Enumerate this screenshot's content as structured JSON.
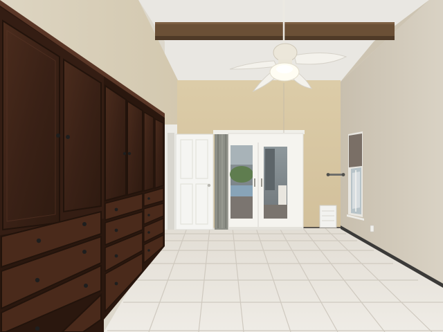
{
  "colors": {
    "ceiling": "#e9e7e2",
    "ceiling_shadow": "#d9d6cf",
    "beam": "#6b5036",
    "beam_shadow": "#4f3a27",
    "back_wall": "#d8c7a4",
    "left_wall": "#d6cdb8",
    "right_wall": "#cfc7b6",
    "cabinet_wood": "#3e2418",
    "cabinet_wood_light": "#5a3626",
    "cabinet_panel": "#4a2a1b",
    "cabinet_edge": "#2a170e",
    "handle": "#1e1e1e",
    "door_white": "#f5f5f2",
    "door_trim": "#f0efe9",
    "glass_outside": "#7f8a8f",
    "glass_reflection": "#a8b3b8",
    "greenery": "#5f7d4f",
    "curtain": "#8d8f87",
    "floor_tile": "#ebe7e0",
    "floor_grout": "#cfc9bf",
    "baseboard": "#3b3a38",
    "fan_white": "#f4f2ec",
    "fan_light": "#fffdf3",
    "vent": "#f2f2ef"
  }
}
